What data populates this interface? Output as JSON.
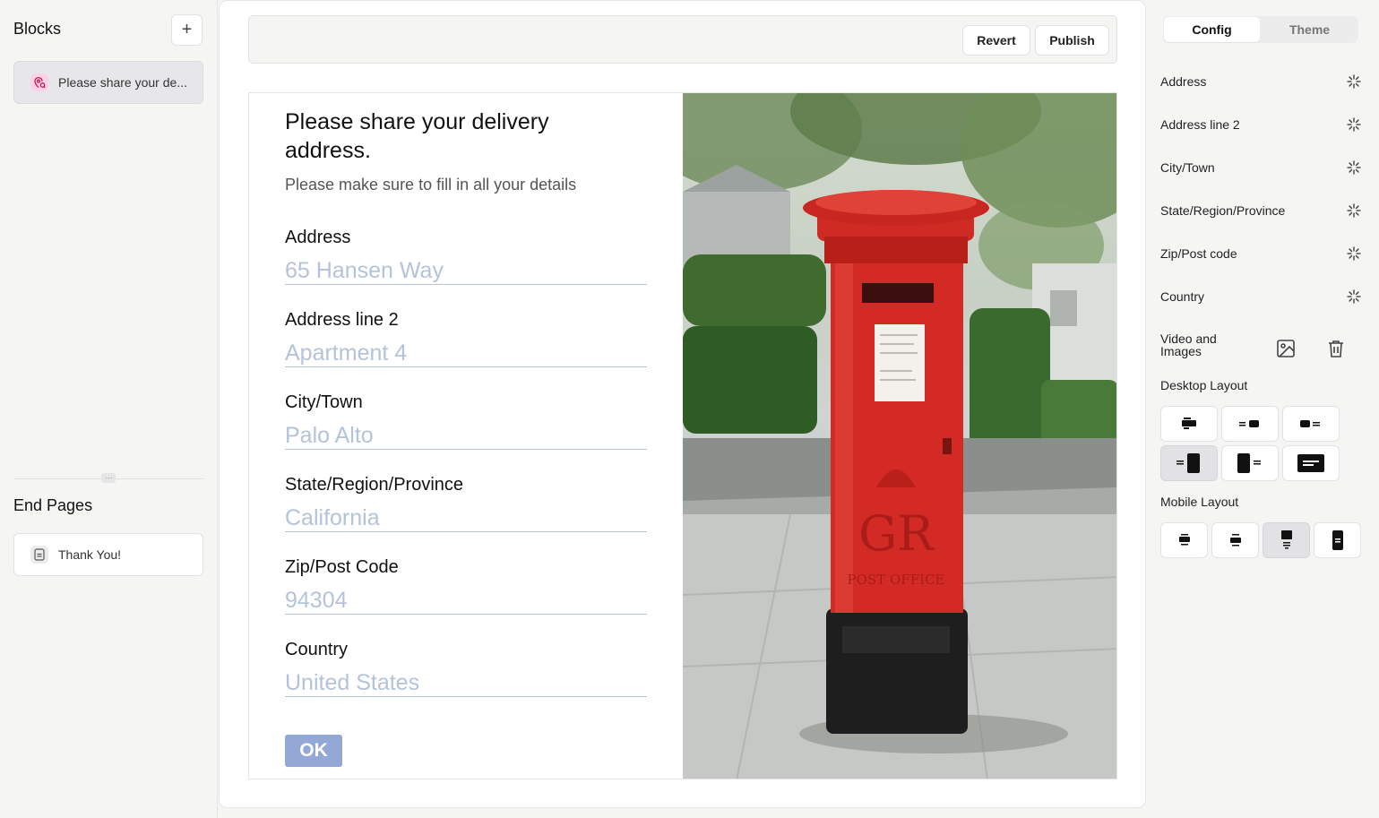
{
  "left_panel": {
    "blocks_title": "Blocks",
    "add_label": "+",
    "blocks": [
      {
        "label": "Please share your de...",
        "icon": "location-pin-icon"
      }
    ],
    "end_pages_title": "End Pages",
    "end_pages": [
      {
        "label": "Thank You!",
        "icon": "document-icon"
      }
    ]
  },
  "toolbar": {
    "revert_label": "Revert",
    "publish_label": "Publish"
  },
  "form": {
    "title": "Please share your delivery address.",
    "subtitle": "Please make sure to fill in all your details",
    "fields": [
      {
        "label": "Address",
        "placeholder": "65 Hansen Way"
      },
      {
        "label": "Address line 2",
        "placeholder": "Apartment 4"
      },
      {
        "label": "City/Town",
        "placeholder": "Palo Alto"
      },
      {
        "label": "State/Region/Province",
        "placeholder": "California"
      },
      {
        "label": "Zip/Post Code",
        "placeholder": "94304"
      },
      {
        "label": "Country",
        "placeholder": "United States"
      }
    ],
    "ok_label": "OK"
  },
  "photo": {
    "description_icon": "red-postbox-photo",
    "embossed_text": "GR",
    "plate_text": "POST OFFICE"
  },
  "right_panel": {
    "tabs": [
      "Config",
      "Theme"
    ],
    "active_tab": "Config",
    "config_fields": [
      "Address",
      "Address line 2",
      "City/Town",
      "State/Region/Province",
      "Zip/Post code",
      "Country"
    ],
    "video_images_label": "Video and Images",
    "desktop_layout_label": "Desktop Layout",
    "mobile_layout_label": "Mobile Layout",
    "desktop_selected_index": 3,
    "mobile_selected_index": 2
  },
  "colors": {
    "ok_button": "#94a8d6",
    "placeholder": "#b4c3da",
    "postbox_red": "#d42a25",
    "block_icon_bg": "#fbd3e6"
  }
}
